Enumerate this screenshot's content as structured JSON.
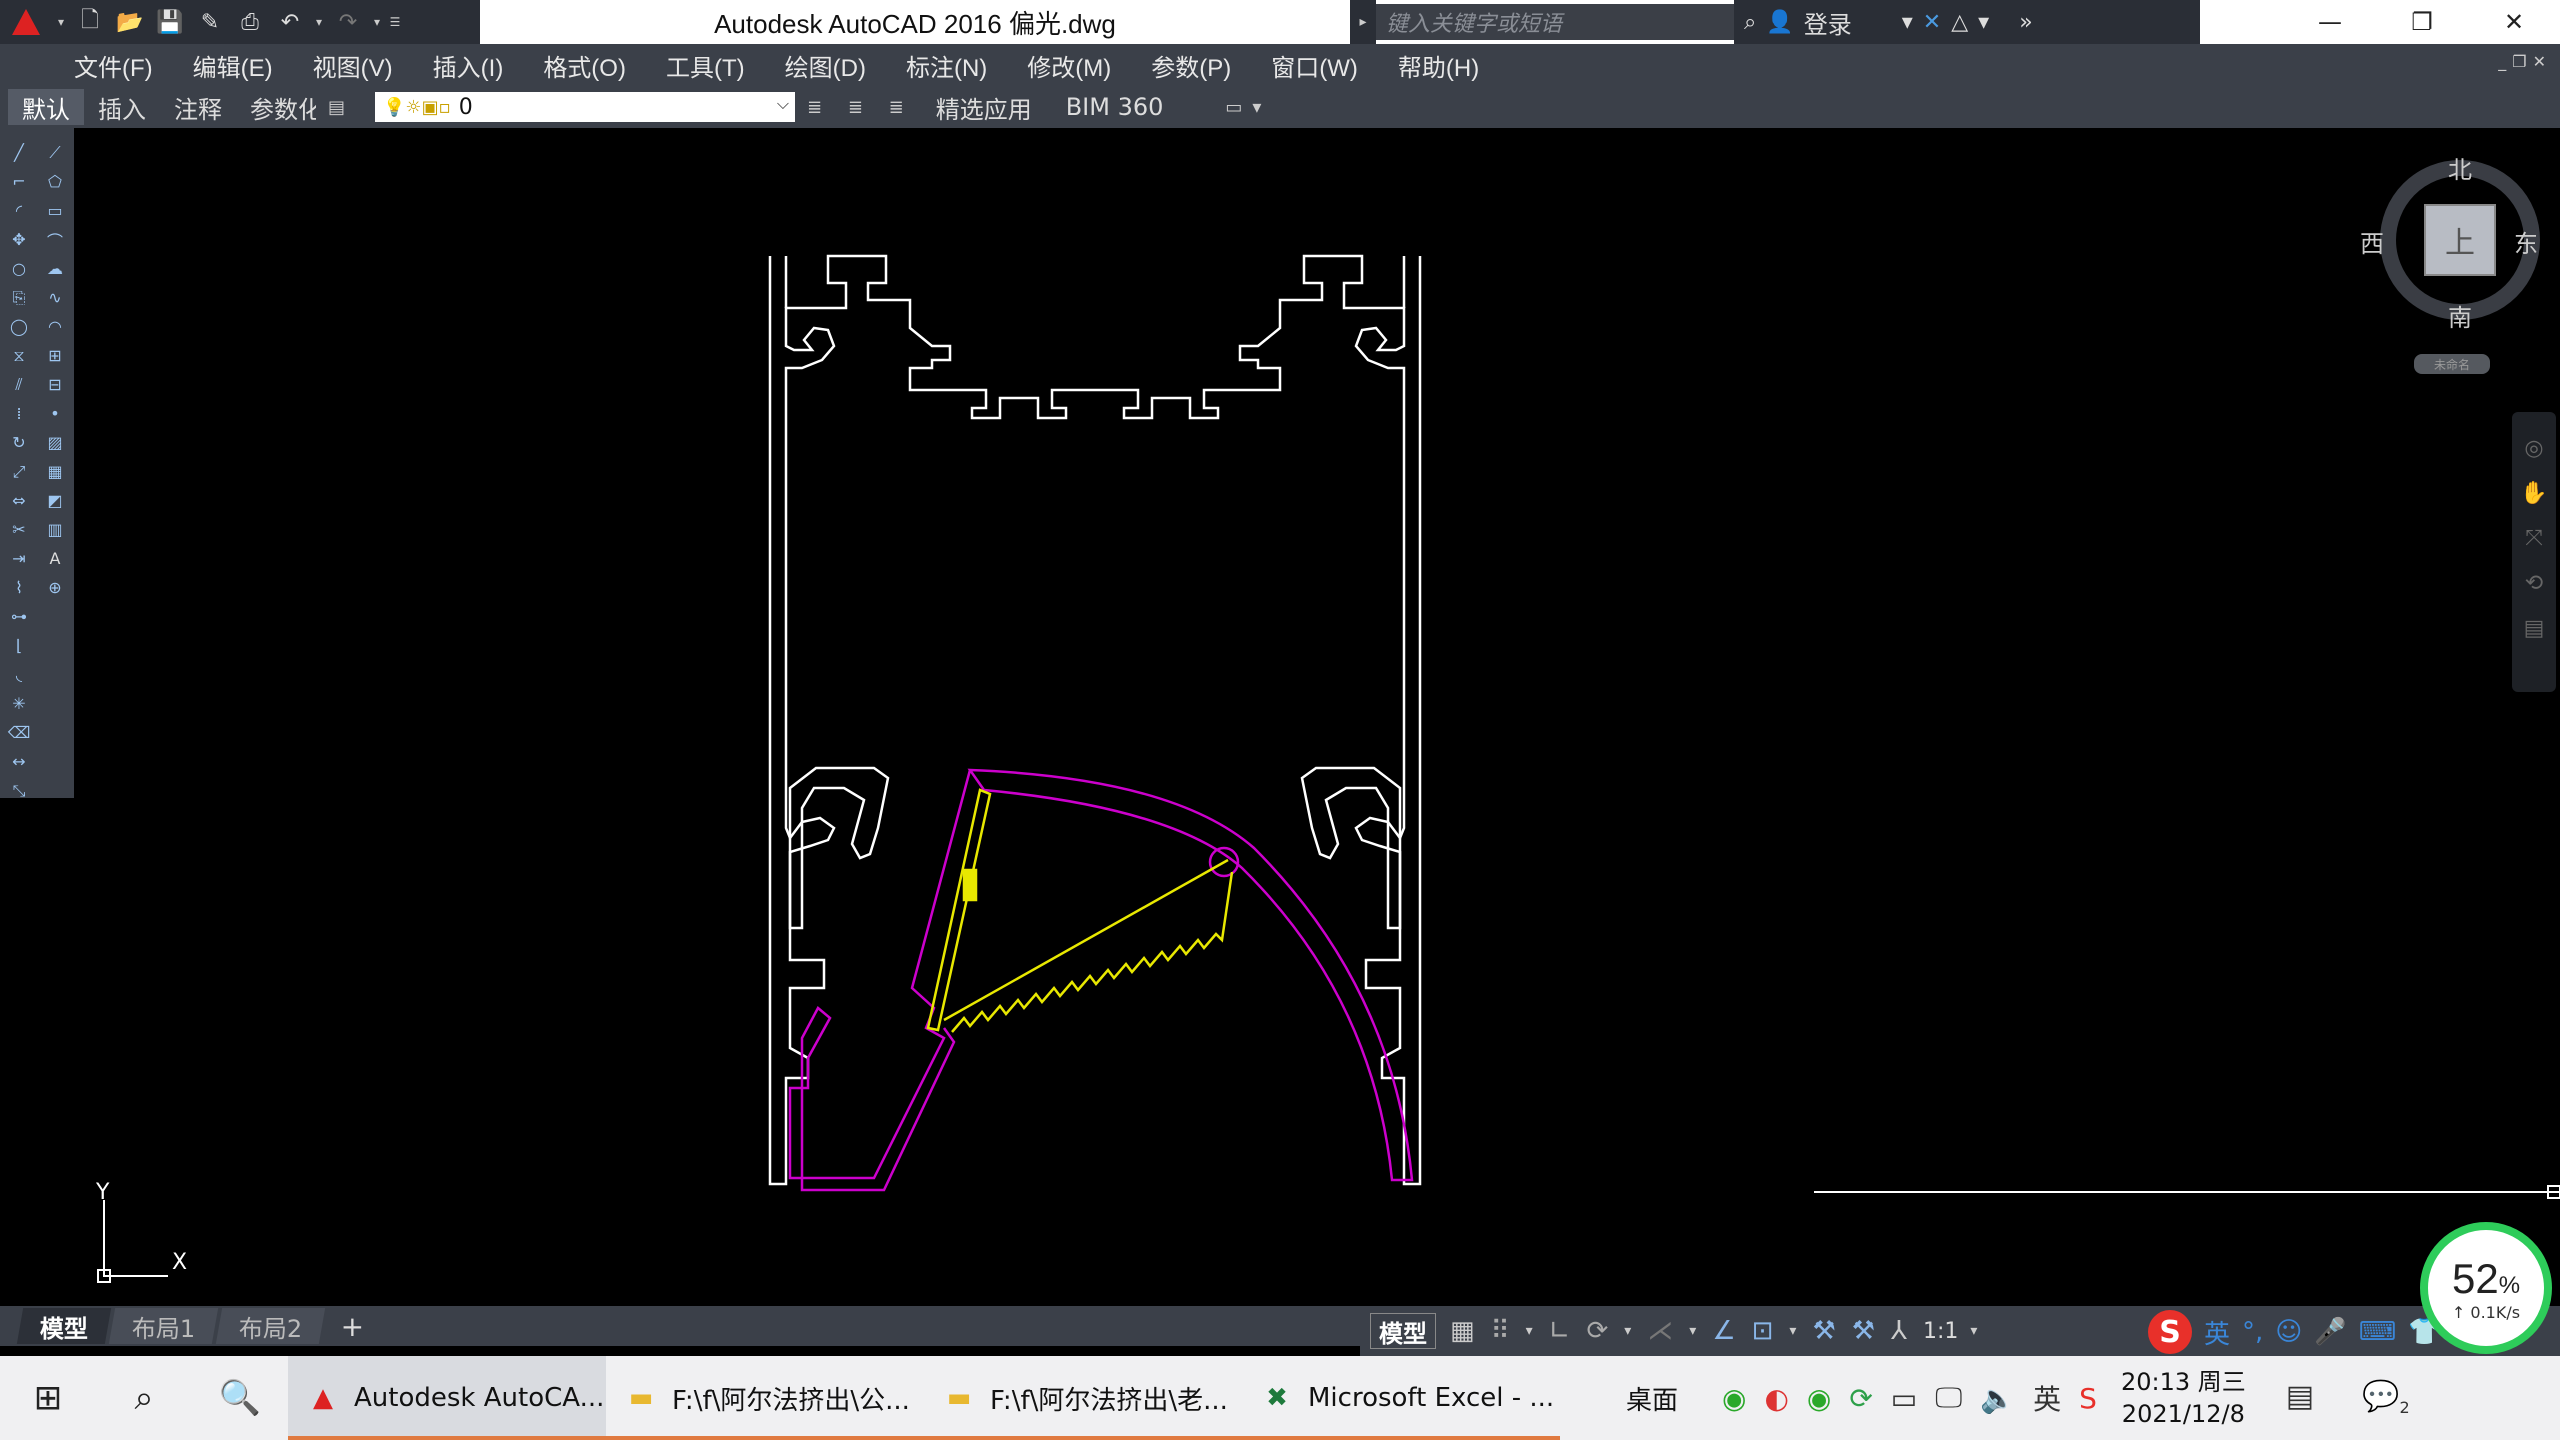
{
  "window": {
    "title": "Autodesk AutoCAD 2016    偏光.dwg",
    "search_placeholder": "键入关键字或短语",
    "login": "登录"
  },
  "menu": [
    "文件(F)",
    "编辑(E)",
    "视图(V)",
    "插入(I)",
    "格式(O)",
    "工具(T)",
    "绘图(D)",
    "标注(N)",
    "修改(M)",
    "参数(P)",
    "窗口(W)",
    "帮助(H)"
  ],
  "ribbon": {
    "tabs": [
      "默认",
      "插入",
      "注释",
      "参数化"
    ],
    "layer_value": "0",
    "extra_tabs": [
      "精选应用",
      "BIM 360"
    ]
  },
  "viewcube": {
    "north": "北",
    "south": "南",
    "east": "东",
    "west": "西",
    "face": "上",
    "wcs": "未命名"
  },
  "ucs": {
    "x": "X",
    "y": "Y"
  },
  "layout_tabs": [
    "模型",
    "布局1",
    "布局2"
  ],
  "status": {
    "model": "模型",
    "scale": "1:1"
  },
  "netmeter": {
    "percent": "52",
    "percent_unit": "%",
    "speed": "↑ 0.1K/s"
  },
  "ime": {
    "lang": "英"
  },
  "taskbar": {
    "apps": [
      {
        "label": "Autodesk AutoCA...",
        "active": true
      },
      {
        "label": "F:\\f\\阿尔法挤出\\公...",
        "active": false
      },
      {
        "label": "F:\\f\\阿尔法挤出\\老...",
        "active": false
      },
      {
        "label": "Microsoft Excel - ...",
        "active": false
      }
    ],
    "desktop": "桌面",
    "ime_lang": "英",
    "time": "20:13 周三",
    "date": "2021/12/8",
    "notify_count": "2"
  },
  "colors": {
    "profile": "#ffffff",
    "diffuser": "#cc00cc",
    "led": "#e8e800",
    "accent_green": "#2ecc5a"
  }
}
